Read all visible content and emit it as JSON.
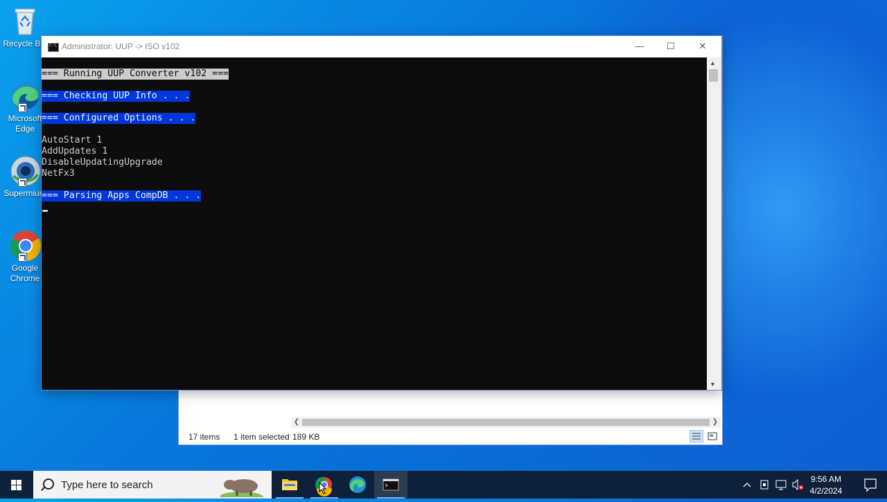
{
  "desktop": {
    "icons": [
      {
        "name": "recycle-bin",
        "label": "Recycle Bin",
        "icon": "recycle-bin-icon"
      },
      {
        "name": "microsoft-edge",
        "label": "Microsoft Edge",
        "icon": "edge-icon"
      },
      {
        "name": "superantispyware",
        "label": "Supermium",
        "icon": "supermium-icon"
      },
      {
        "name": "google-chrome",
        "label": "Google Chrome",
        "icon": "chrome-icon"
      }
    ]
  },
  "explorer": {
    "status_items": "17 items",
    "status_selected": "1 item selected",
    "status_size": "189 KB"
  },
  "cmd": {
    "title": "Administrator:  UUP -> ISO v102",
    "lines": {
      "l1": "=== Running UUP Converter v102 ===",
      "l2": "=== Checking UUP Info . . .",
      "l3": "=== Configured Options . . .",
      "l4": "AutoStart 1",
      "l5": "AddUpdates 1",
      "l6": "DisableUpdatingUpgrade",
      "l7": "NetFx3",
      "l8": "=== Parsing Apps CompDB . . ."
    },
    "colors": {
      "console_bg": "#0c0c0c",
      "console_fg": "#cccccc",
      "selection_blue": "#0037da"
    }
  },
  "taskbar": {
    "search_placeholder": "Type here to search",
    "apps": [
      "file-explorer-icon",
      "supermium-icon",
      "edge-icon",
      "command-prompt-icon"
    ],
    "clock_time": "9:56 AM",
    "clock_date": "4/2/2024"
  }
}
